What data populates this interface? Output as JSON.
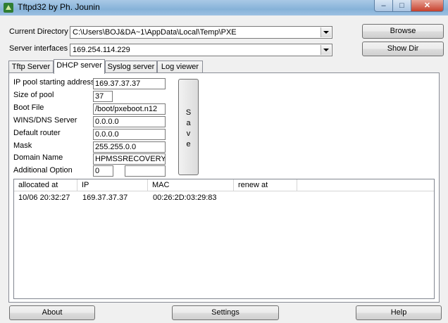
{
  "window": {
    "title": "Tftpd32 by Ph. Jounin",
    "min_label": "–",
    "max_label": "□",
    "close_label": "✕"
  },
  "top": {
    "current_directory_label": "Current Directory",
    "current_directory_value": "C:\\Users\\BOJ&DA~1\\AppData\\Local\\Temp\\PXE",
    "server_interfaces_label": "Server interfaces",
    "server_interfaces_value": "169.254.114.229",
    "browse_label": "Browse",
    "show_dir_label": "Show Dir"
  },
  "tabs": [
    {
      "label": "Tftp Server"
    },
    {
      "label": "DHCP server"
    },
    {
      "label": "Syslog server"
    },
    {
      "label": "Log viewer"
    }
  ],
  "dhcp": {
    "ip_pool_label": "IP pool starting address",
    "ip_pool_value": "169.37.37.37",
    "pool_size_label": "Size of pool",
    "pool_size_value": "37",
    "boot_file_label": "Boot File",
    "boot_file_value": "/boot/pxeboot.n12",
    "wins_dns_label": "WINS/DNS Server",
    "wins_dns_value": "0.0.0.0",
    "default_router_label": "Default router",
    "default_router_value": "0.0.0.0",
    "mask_label": "Mask",
    "mask_value": "255.255.0.0",
    "domain_name_label": "Domain Name",
    "domain_name_value": "HPMSSRECOVERY",
    "additional_option_label": "Additional Option",
    "additional_option_value": "0",
    "additional_option_extra": "",
    "save_chars": [
      "S",
      "a",
      "v",
      "e"
    ]
  },
  "leases": {
    "columns": [
      "allocated at",
      "IP",
      "MAC",
      "renew at"
    ],
    "rows": [
      [
        "10/06 20:32:27",
        "169.37.37.37",
        "00:26:2D:03:29:83",
        ""
      ]
    ]
  },
  "bottom": {
    "about_label": "About",
    "settings_label": "Settings",
    "help_label": "Help"
  }
}
